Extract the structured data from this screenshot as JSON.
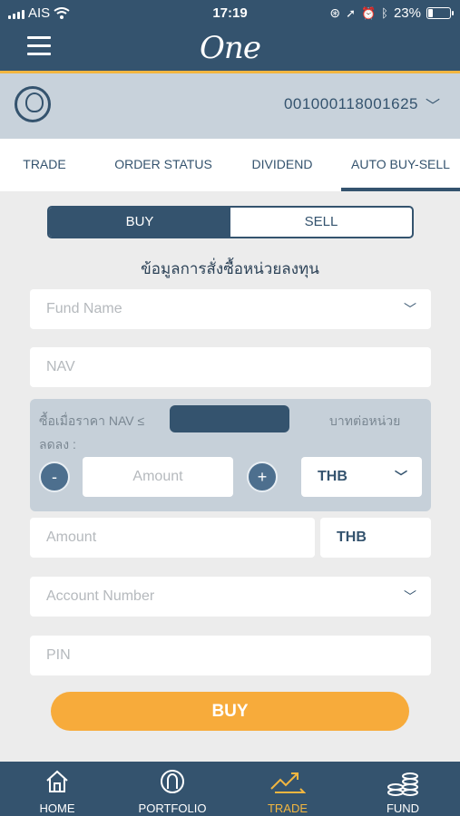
{
  "status_bar": {
    "carrier": "AIS",
    "time": "17:19",
    "battery": "23%",
    "battery_level": 0.23
  },
  "header": {
    "logo_text": "One",
    "colors": {
      "primary": "#34536e",
      "accent": "#f2b640",
      "button": "#f7ab3b"
    }
  },
  "account": {
    "number": "001000118001625"
  },
  "tabs": [
    {
      "label": "TRADE",
      "active": false
    },
    {
      "label": "ORDER STATUS",
      "active": false
    },
    {
      "label": "DIVIDEND",
      "active": false
    },
    {
      "label": "AUTO BUY-SELL",
      "active": true
    }
  ],
  "toggle": {
    "buy": "BUY",
    "sell": "SELL",
    "selected": "BUY"
  },
  "form": {
    "title": "ข้อมูลการสั่งซื้อหน่วยลงทุน",
    "fund_name_placeholder": "Fund Name",
    "nav_placeholder": "NAV",
    "nav_condition_label": "ซื้อเมื่อราคา NAV ≤",
    "nav_condition_label2": "ลดลง :",
    "nav_unit": "บาทต่อหน่วย",
    "minus": "-",
    "plus": "+",
    "amount_placeholder": "Amount",
    "currency": "THB",
    "amount2_placeholder": "Amount",
    "currency2": "THB",
    "account_number_placeholder": "Account Number",
    "pin_placeholder": "PIN",
    "submit": "BUY"
  },
  "bottom_nav": [
    {
      "label": "HOME",
      "icon": "home-icon",
      "active": false
    },
    {
      "label": "PORTFOLIO",
      "icon": "portfolio-icon",
      "active": false
    },
    {
      "label": "TRADE",
      "icon": "trade-icon",
      "active": true
    },
    {
      "label": "FUND",
      "icon": "fund-coins-icon",
      "active": false
    }
  ]
}
